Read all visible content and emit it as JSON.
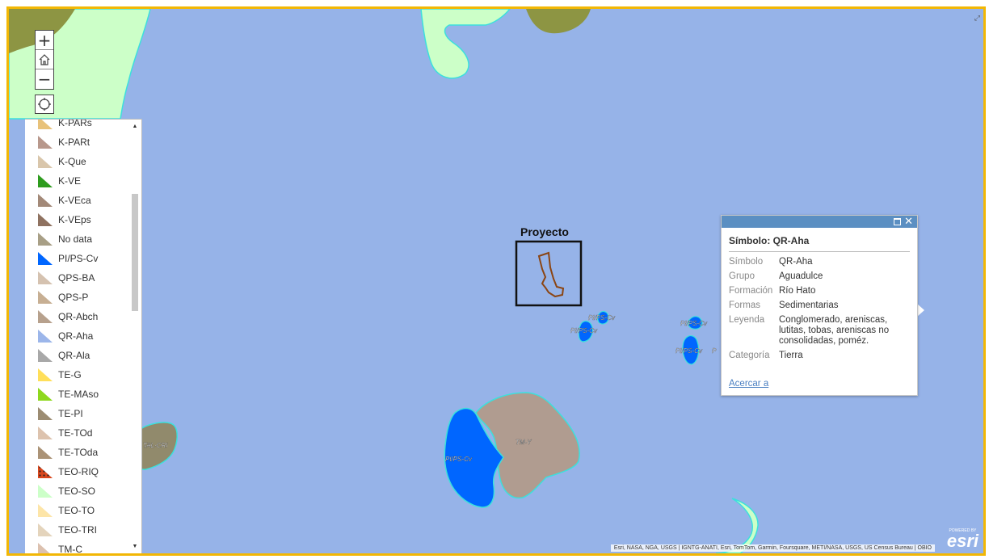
{
  "map": {
    "project_label": "Proyecto",
    "feature_labels": [
      {
        "id": "plps-cv-small-1",
        "text": "PI/PS-Cv"
      },
      {
        "id": "plps-cv-small-2",
        "text": "PI/PS-Cv"
      },
      {
        "id": "plps-cv-east-1",
        "text": "PI/PS-Cv"
      },
      {
        "id": "plps-cv-east-2",
        "text": "PI/PS-Cv"
      },
      {
        "id": "east-cut",
        "text": "P"
      },
      {
        "id": "plps-cv-large",
        "text": "PI/PS-Cv"
      },
      {
        "id": "tm-y",
        "text": "TM-Y"
      },
      {
        "id": "tal-cri",
        "text": "TAL-CRI"
      }
    ],
    "colors": {
      "water": "#96b3e8",
      "plps_cv": "#0066ff",
      "tm_y": "#b09c90",
      "teo_so": "#ccffc8",
      "olive": "#8d9543",
      "tal_cri": "#918a6c",
      "outline": "#3ce0dc",
      "project_outline": "#8b4513"
    }
  },
  "controls": {
    "zoom_in": "+",
    "zoom_out": "−",
    "home_icon": "home-icon",
    "locate_icon": "locate-icon"
  },
  "legend": {
    "items": [
      {
        "label": "K-PARs",
        "color": "#e8c27a"
      },
      {
        "label": "K-PARt",
        "color": "#b8988c"
      },
      {
        "label": "K-Que",
        "color": "#d9c6ab"
      },
      {
        "label": "K-VE",
        "color": "#2e9c1e"
      },
      {
        "label": "K-VEca",
        "color": "#a38978"
      },
      {
        "label": "K-VEps",
        "color": "#8f7260"
      },
      {
        "label": "No data",
        "color": "#a89f86"
      },
      {
        "label": "PI/PS-Cv",
        "color": "#0066ff"
      },
      {
        "label": "QPS-BA",
        "color": "#d5c2b0"
      },
      {
        "label": "QPS-P",
        "color": "#c7af93"
      },
      {
        "label": "QR-Abch",
        "color": "#b7a18d"
      },
      {
        "label": "QR-Aha",
        "color": "#9cb6ea"
      },
      {
        "label": "QR-Ala",
        "color": "#a8a8a8"
      },
      {
        "label": "TE-G",
        "color": "#ffdf5a"
      },
      {
        "label": "TE-MAso",
        "color": "#8ed81e"
      },
      {
        "label": "TE-PI",
        "color": "#9c8c72"
      },
      {
        "label": "TE-TOd",
        "color": "#ddc3ae"
      },
      {
        "label": "TE-TOda",
        "color": "#ab9377"
      },
      {
        "label": "TEO-RIQ",
        "color": "#d9461c"
      },
      {
        "label": "TEO-SO",
        "color": "#ccffc8"
      },
      {
        "label": "TEO-TO",
        "color": "#fde5a8"
      },
      {
        "label": "TEO-TRI",
        "color": "#e4d4bc"
      },
      {
        "label": "TM-C",
        "color": "#dcc1af"
      }
    ]
  },
  "popup": {
    "title": "Símbolo: QR-Aha",
    "fields": [
      {
        "key": "Símbolo",
        "value": "QR-Aha"
      },
      {
        "key": "Grupo",
        "value": "Aguadulce"
      },
      {
        "key": "Formación",
        "value": "Río Hato"
      },
      {
        "key": "Formas",
        "value": "Sedimentarias"
      },
      {
        "key": "Leyenda",
        "value": "Conglomerado, areniscas, lutitas, tobas, areniscas no consolidadas, poméz."
      },
      {
        "key": "Categoría",
        "value": "Tierra"
      }
    ],
    "zoom_link": "Acercar a",
    "maximize_icon": "maximize-icon",
    "close_label": "✕"
  },
  "attribution": {
    "text": "Esri, NASA, NGA, USGS | IGNTG-ANATI, Esri, TomTom, Garmin, Foursquare, METI/NASA, USGS, US Census Bureau | OBIO",
    "logo_powered": "POWERED BY",
    "logo_name": "esri"
  }
}
